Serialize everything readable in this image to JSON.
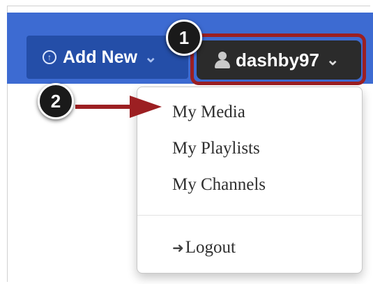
{
  "navbar": {
    "add_new_label": "Add New",
    "add_new_icon": "circle-arrow-up-icon",
    "add_new_chevron": "chevron-down-icon",
    "user_label": "dashby97",
    "user_icon": "user-icon",
    "user_chevron": "chevron-down-icon",
    "bar_color": "#3d6bd2",
    "user_button_color": "#2b2b2b"
  },
  "dropdown": {
    "items": [
      {
        "label": "My Media"
      },
      {
        "label": "My Playlists"
      },
      {
        "label": "My Channels"
      }
    ],
    "logout_label": "Logout",
    "logout_icon": "sign-out-icon"
  },
  "annotations": {
    "step1": "1",
    "step2": "2",
    "highlight_color": "#9c1f22",
    "arrow_color": "#9c1f22"
  }
}
